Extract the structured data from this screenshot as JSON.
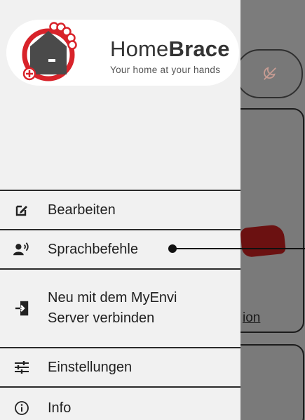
{
  "app": {
    "brand_light": "Home",
    "brand_bold": "Brace",
    "tagline": "Your home at your hands"
  },
  "background": {
    "link_text": "ion"
  },
  "menu": {
    "items": [
      {
        "label": "Bearbeiten",
        "icon": "edit-icon"
      },
      {
        "label": "Sprachbefehle",
        "icon": "voice-command-icon"
      },
      {
        "label": "Neu mit dem MyEnvi\nServer verbinden",
        "icon": "login-icon"
      },
      {
        "label": "Einstellungen",
        "icon": "sliders-icon"
      },
      {
        "label": "Info",
        "icon": "info-icon"
      }
    ]
  },
  "colors": {
    "brand_red": "#d8232a",
    "house": "#4a4a4a",
    "drawer_bg": "#f1f1f1",
    "scrim": "#7a7a7a"
  }
}
